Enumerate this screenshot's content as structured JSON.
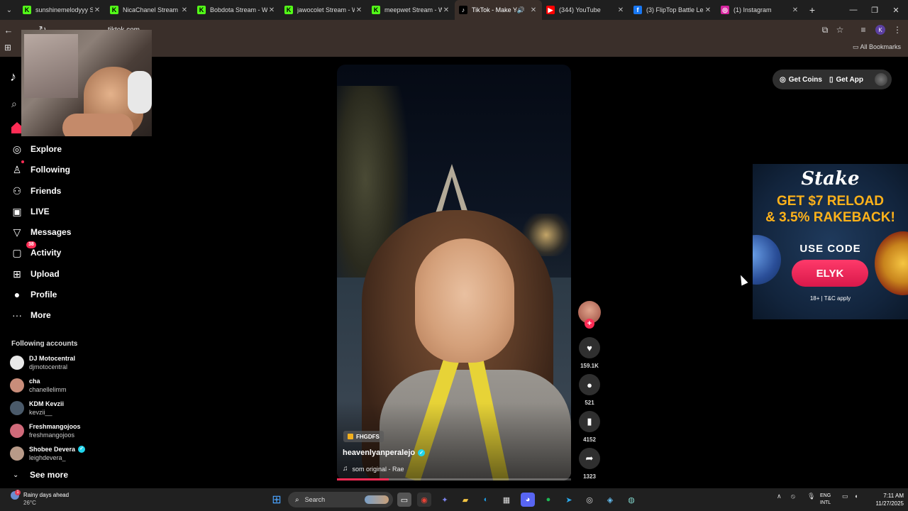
{
  "browser": {
    "tabs": [
      {
        "title": "sunshinemelodyyy St",
        "favicon_color": "#53fc18",
        "favicon_glyph": "K",
        "active": false
      },
      {
        "title": "NicaChanel Stream -",
        "favicon_color": "#53fc18",
        "favicon_glyph": "K",
        "active": false
      },
      {
        "title": "Bobdota Stream - We",
        "favicon_color": "#53fc18",
        "favicon_glyph": "K",
        "active": false
      },
      {
        "title": "jawocolet Stream - W",
        "favicon_color": "#53fc18",
        "favicon_glyph": "K",
        "active": false
      },
      {
        "title": "meepwet Stream - W",
        "favicon_color": "#53fc18",
        "favicon_glyph": "K",
        "active": false
      },
      {
        "title": "TikTok - Make Yo",
        "favicon_color": "#000000",
        "favicon_glyph": "♪",
        "active": true
      },
      {
        "title": "(344) YouTube",
        "favicon_color": "#ff0000",
        "favicon_glyph": "▶",
        "active": false
      },
      {
        "title": "(3) FlipTop Battle Lea",
        "favicon_color": "#1877f2",
        "favicon_glyph": "f",
        "active": false
      },
      {
        "title": "(1) Instagram",
        "favicon_color": "#d6249f",
        "favicon_glyph": "◎",
        "active": false
      }
    ],
    "new_tab_label": "+",
    "url": "tiktok.com",
    "all_bookmarks_label": "All Bookmarks",
    "profile_initial": "K"
  },
  "sidebar": {
    "items": [
      {
        "label": "Explore",
        "icon": "compass-icon",
        "glyph": "◎"
      },
      {
        "label": "Following",
        "icon": "following-icon",
        "glyph": "♙"
      },
      {
        "label": "Friends",
        "icon": "friends-icon",
        "glyph": "⚇"
      },
      {
        "label": "LIVE",
        "icon": "live-icon",
        "glyph": "▣"
      },
      {
        "label": "Messages",
        "icon": "messages-icon",
        "glyph": "▽"
      },
      {
        "label": "Activity",
        "icon": "activity-icon",
        "glyph": "▢",
        "badge": "38"
      },
      {
        "label": "Upload",
        "icon": "upload-icon",
        "glyph": "⊞"
      },
      {
        "label": "Profile",
        "icon": "profile-icon",
        "glyph": "●"
      },
      {
        "label": "More",
        "icon": "more-icon",
        "glyph": "···"
      }
    ],
    "following_title": "Following accounts",
    "following_accounts": [
      {
        "name": "DJ Motocentral",
        "username": "djmotocentral",
        "avatar_color": "#e9e9e9",
        "verified": false
      },
      {
        "name": "cha",
        "username": "chanellelimm",
        "avatar_color": "#c98d7a",
        "verified": false
      },
      {
        "name": "KDM Kevzii",
        "username": "kevzii__",
        "avatar_color": "#4a5a6a",
        "verified": false
      },
      {
        "name": "Freshmangojoos",
        "username": "freshmangojoos",
        "avatar_color": "#d06a7a",
        "verified": false
      },
      {
        "name": "Shobee Devera",
        "username": "leighdevera_",
        "avatar_color": "#b89a88",
        "verified": true
      }
    ],
    "see_more_label": "See more"
  },
  "top_actions": {
    "get_coins_label": "Get Coins",
    "get_app_label": "Get App"
  },
  "video": {
    "tag_label": "FHGDFS",
    "username": "heavenlyanperalejo",
    "verified": true,
    "music": "som original - Rae",
    "progress": 0.22
  },
  "actions": {
    "likes": "159.1K",
    "comments": "521",
    "saves": "4152",
    "shares": "1323"
  },
  "ad": {
    "brand": "Stake",
    "headline_line1": "GET $7 RELOAD",
    "headline_line2": "& 3.5% RAKEBACK!",
    "use_code_label": "USE CODE",
    "code": "ELYK",
    "legal": "18+ | T&C apply"
  },
  "taskbar": {
    "weather_title": "Rainy days ahead",
    "weather_temp": "26°C",
    "weather_badge": "1",
    "search_label": "Search",
    "lang_line1": "ENG",
    "lang_line2": "INTL",
    "time": "7:11 AM",
    "date": "11/27/2025"
  }
}
